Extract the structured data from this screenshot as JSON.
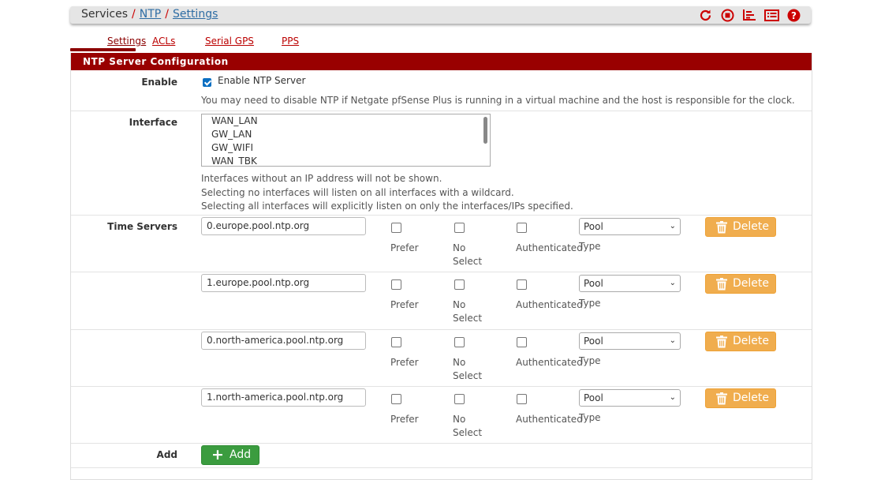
{
  "breadcrumb": {
    "root": "Services",
    "link1": "NTP",
    "link2": "Settings",
    "separator": "/"
  },
  "header_icons": [
    "reload-icon",
    "stop-icon",
    "graph-icon",
    "list-icon",
    "help-icon"
  ],
  "tabs": [
    {
      "label": "Settings",
      "active": true
    },
    {
      "label": "ACLs",
      "active": false
    },
    {
      "label": "Serial GPS",
      "active": false
    },
    {
      "label": "PPS",
      "active": false
    }
  ],
  "panel": {
    "title": "NTP Server Configuration"
  },
  "enable": {
    "label": "Enable",
    "checkbox_label": "Enable NTP Server",
    "checked": true,
    "help": "You may need to disable NTP if Netgate pfSense Plus is running in a virtual machine and the host is responsible for the clock."
  },
  "interface": {
    "label": "Interface",
    "options": [
      "WAN_LAN",
      "GW_LAN",
      "GW_WIFI",
      "WAN_TBK"
    ],
    "help1": "Interfaces without an IP address will not be shown.",
    "help2": "Selecting no interfaces will listen on all interfaces with a wildcard.",
    "help3": "Selecting all interfaces will explicitly listen on only the interfaces/IPs specified."
  },
  "time_servers": {
    "label": "Time Servers",
    "prefer_label": "Prefer",
    "noselect_label_1": "No",
    "noselect_label_2": "Select",
    "auth_label": "Authenticated",
    "type_label": "Type",
    "delete_label": "Delete",
    "servers": [
      {
        "host": "0.europe.pool.ntp.org",
        "type": "Pool"
      },
      {
        "host": "1.europe.pool.ntp.org",
        "type": "Pool"
      },
      {
        "host": "0.north-america.pool.ntp.org",
        "type": "Pool"
      },
      {
        "host": "1.north-america.pool.ntp.org",
        "type": "Pool"
      }
    ]
  },
  "add": {
    "label": "Add",
    "button_label": "Add"
  },
  "colors": {
    "panel_header": "#990000",
    "tab_accent": "#8b0000",
    "link": "#2e6da4",
    "delete_button": "#f0ad4e",
    "add_button": "#3b9c3f",
    "checkbox_checked": "#0b6fc2"
  }
}
